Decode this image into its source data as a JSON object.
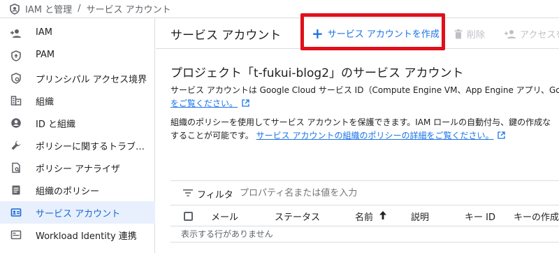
{
  "breadcrumb": {
    "section": "IAM と管理",
    "separator": "/",
    "page": "サービス アカウント"
  },
  "nav": {
    "items": [
      {
        "icon": "person-add-icon",
        "label": "IAM"
      },
      {
        "icon": "shield-icon",
        "label": "PAM"
      },
      {
        "icon": "principal-access-icon",
        "label": "プリンシパル アクセス境界"
      },
      {
        "icon": "organization-icon",
        "label": "組織"
      },
      {
        "icon": "account-circle-icon",
        "label": "ID と組織"
      },
      {
        "icon": "wrench-icon",
        "label": "ポリシーに関するトラブ…"
      },
      {
        "icon": "policy-analyzer-icon",
        "label": "ポリシー アナライザ"
      },
      {
        "icon": "document-icon",
        "label": "組織のポリシー"
      },
      {
        "icon": "service-account-icon",
        "label": "サービス アカウント",
        "active": true
      },
      {
        "icon": "workload-identity-icon",
        "label": "Workload Identity 連携"
      }
    ]
  },
  "toolbar": {
    "title": "サービス アカウント",
    "create_label": "サービス アカウントを作成",
    "delete_label": "削除",
    "access_label": "アクセスを"
  },
  "colors": {
    "accent": "#1a73e8",
    "highlight": "#e0101b",
    "active_bg": "#e8f0fe"
  },
  "main": {
    "project_heading": "プロジェクト「t-fukui-blog2」のサービス アカウント",
    "intro_line": "サービス アカウントは Google Cloud サービス ID（Compute Engine VM、App Engine アプリ、Goog",
    "intro_link": "をご覧ください。",
    "policy_line1": "組織のポリシーを使用してサービス アカウントを保護できます。IAM ロールの自動付与、鍵の作成な",
    "policy_line2_prefix": "することが可能です。",
    "policy_link": "サービス アカウントの組織のポリシーの詳細をご覧ください。"
  },
  "filter": {
    "label": "フィルタ",
    "placeholder": "プロパティ名または値を入力"
  },
  "table": {
    "columns": [
      "メール",
      "ステータス",
      "名前",
      "説明",
      "キー ID",
      "キーの作成日"
    ],
    "sorted_column": "名前",
    "sort_direction": "ascending",
    "empty_message": "表示する行がありません"
  }
}
